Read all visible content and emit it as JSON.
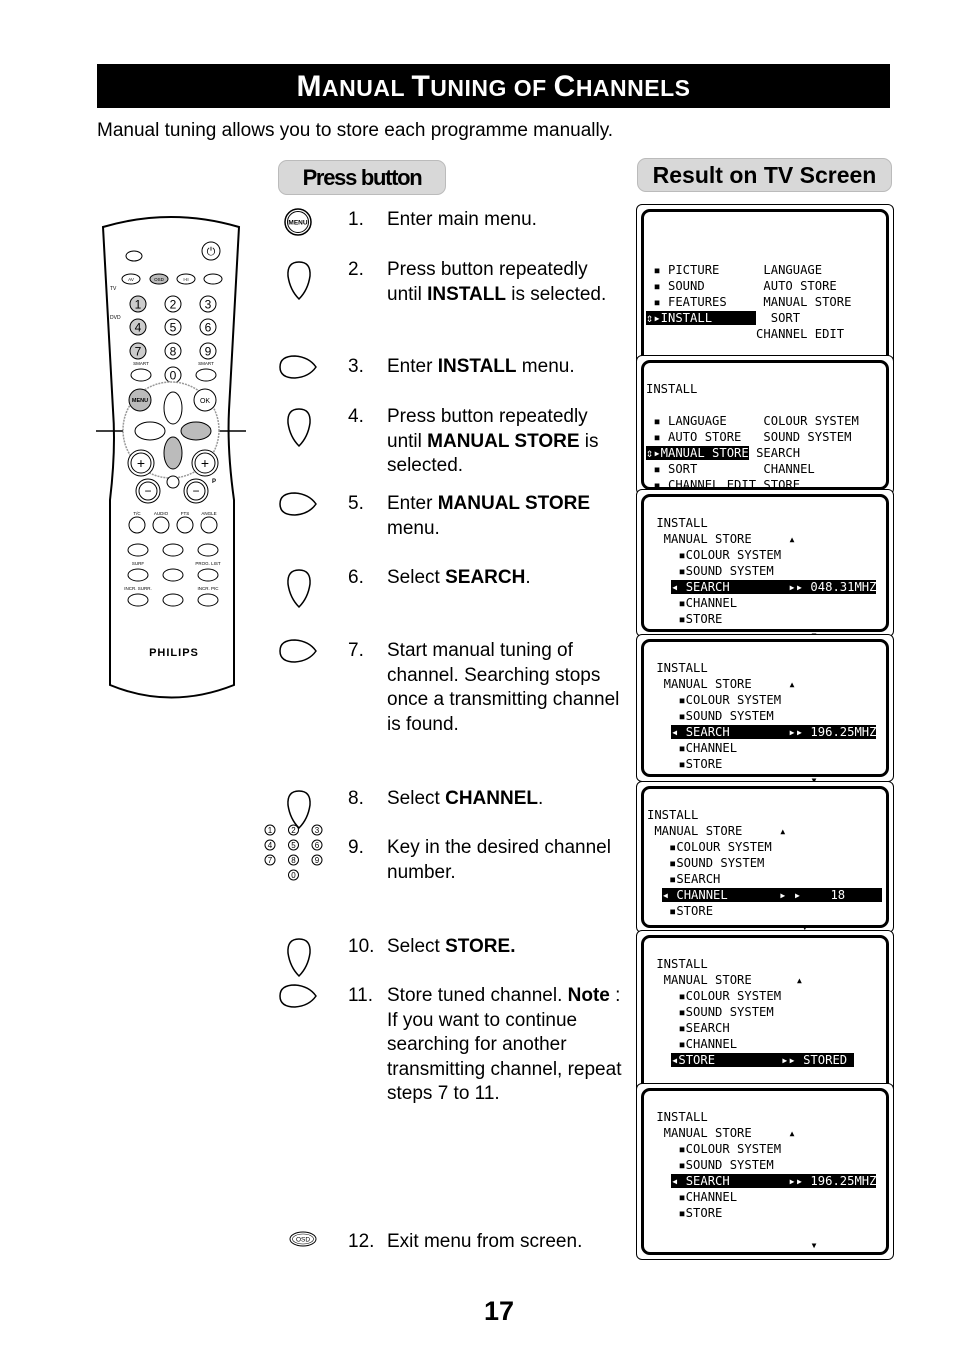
{
  "title": {
    "parts": [
      [
        "M",
        "big"
      ],
      [
        "ANUAL ",
        ""
      ],
      [
        "T",
        "big"
      ],
      [
        "UNING OF ",
        ""
      ],
      [
        "C",
        "big"
      ],
      [
        "HANNELS",
        ""
      ]
    ]
  },
  "intro": "Manual tuning allows you to store each programme manually.",
  "press_button_label": "Press button",
  "result_label": "Result on TV Screen",
  "remote": {
    "brand": "PHILIPS",
    "labels": {
      "tv": "TV",
      "dvd": "DVD",
      "av": "AV",
      "osd": "OSD",
      "dual": "I-II",
      "smart1": "SMART",
      "smart2": "SMART",
      "menu": "MENU",
      "ok": "OK",
      "p": "P",
      "tc": "T/C",
      "audio": "AUDIO",
      "fts": "FTS",
      "angle": "ANGLE",
      "surf": "SURF",
      "prog_list": "PROG. LIST",
      "incr_surr": "INCR. SURR.",
      "incr_pic": "INCR. PIC"
    },
    "digits": [
      "1",
      "2",
      "3",
      "4",
      "5",
      "6",
      "7",
      "8",
      "9",
      "0"
    ]
  },
  "steps": [
    {
      "num": "1.",
      "icon": "menu",
      "segments": [
        [
          "Enter main menu.",
          false
        ]
      ]
    },
    {
      "num": "2.",
      "icon": "down",
      "segments": [
        [
          "Press button repeatedly until ",
          false
        ],
        [
          "INSTALL",
          true
        ],
        [
          " is selected.",
          false
        ]
      ]
    },
    {
      "num": "3.",
      "icon": "right",
      "segments": [
        [
          "Enter ",
          false
        ],
        [
          "INSTALL",
          true
        ],
        [
          " menu.",
          false
        ]
      ]
    },
    {
      "num": "4.",
      "icon": "down",
      "segments": [
        [
          "Press button repeatedly until ",
          false
        ],
        [
          "MANUAL STORE",
          true
        ],
        [
          " is selected.",
          false
        ]
      ]
    },
    {
      "num": "5.",
      "icon": "right",
      "segments": [
        [
          "Enter ",
          false
        ],
        [
          "MANUAL STORE",
          true
        ],
        [
          " menu.",
          false
        ]
      ]
    },
    {
      "num": "6.",
      "icon": "down",
      "segments": [
        [
          "Select ",
          false
        ],
        [
          "SEARCH",
          true
        ],
        [
          ".",
          false
        ]
      ]
    },
    {
      "num": "7.",
      "icon": "right",
      "segments": [
        [
          "Start manual tuning of channel. Searching stops once a transmitting channel is found.",
          false
        ]
      ]
    },
    {
      "num": "8.",
      "icon": "down",
      "segments": [
        [
          "Select ",
          false
        ],
        [
          "CHANNEL",
          true
        ],
        [
          ".",
          false
        ]
      ]
    },
    {
      "num": "9.",
      "icon": "digits",
      "segments": [
        [
          "Key in the desired channel number.",
          false
        ]
      ]
    },
    {
      "num": "10.",
      "icon": "down",
      "segments": [
        [
          "Select ",
          false
        ],
        [
          "STORE.",
          true
        ]
      ]
    },
    {
      "num": "11.",
      "icon": "right",
      "segments": [
        [
          "Store tuned  channel. ",
          false
        ],
        [
          "Note",
          true
        ],
        [
          " : If you want to continue searching for another transmitting channel, repeat steps 7 to 11.",
          false
        ]
      ]
    },
    {
      "num": "12.",
      "icon": "osd",
      "segments": [
        [
          "Exit menu from screen.",
          false
        ]
      ]
    }
  ],
  "osd_label": "OSD",
  "screens": [
    {
      "lines": [
        [
          "",
          "",
          ""
        ],
        [
          "",
          "",
          ""
        ],
        [
          "",
          "",
          ""
        ],
        [
          " ▪ PICTURE      LANGUAGE",
          "",
          ""
        ],
        [
          " ▪ SOUND        AUTO STORE",
          "",
          ""
        ],
        [
          " ▪ FEATURES     MANUAL STORE",
          "",
          ""
        ],
        [
          "",
          "⇕▸INSTALL      ",
          "  SORT"
        ],
        [
          "               CHANNEL EDIT",
          "",
          ""
        ]
      ]
    },
    {
      "lines": [
        [
          "",
          "",
          ""
        ],
        [
          "INSTALL",
          "",
          ""
        ],
        [
          "",
          "",
          ""
        ],
        [
          " ▪ LANGUAGE     COLOUR SYSTEM",
          "",
          ""
        ],
        [
          " ▪ AUTO STORE   SOUND SYSTEM",
          "",
          ""
        ],
        [
          "",
          "⇕▸MANUAL STORE",
          " SEARCH"
        ],
        [
          " ▪ SORT         CHANNEL",
          "",
          ""
        ],
        [
          " ▪ CHANNEL EDIT STORE",
          "",
          ""
        ],
        [
          " ▪",
          "",
          ""
        ]
      ]
    },
    {
      "lines": [
        [
          "",
          "",
          ""
        ],
        [
          " INSTALL",
          "",
          ""
        ],
        [
          "  MANUAL STORE     ▴",
          "",
          ""
        ],
        [
          "    ▪COLOUR SYSTEM",
          "",
          ""
        ],
        [
          "    ▪SOUND SYSTEM",
          "",
          ""
        ],
        [
          "   ",
          "◂ SEARCH        ▸▸ 048.31MHZ",
          ""
        ],
        [
          "    ▪CHANNEL",
          "",
          ""
        ],
        [
          "    ▪STORE",
          "",
          ""
        ],
        [
          "                      ▾",
          "",
          ""
        ]
      ]
    },
    {
      "lines": [
        [
          "",
          "",
          ""
        ],
        [
          " INSTALL",
          "",
          ""
        ],
        [
          "  MANUAL STORE     ▴",
          "",
          ""
        ],
        [
          "    ▪COLOUR SYSTEM",
          "",
          ""
        ],
        [
          "    ▪SOUND SYSTEM",
          "",
          ""
        ],
        [
          "   ",
          "◂ SEARCH        ▸▸ 196.25MHZ",
          ""
        ],
        [
          "    ▪CHANNEL",
          "",
          ""
        ],
        [
          "    ▪STORE",
          "",
          ""
        ],
        [
          "                      ▾",
          "",
          ""
        ]
      ]
    },
    {
      "lines": [
        [
          "",
          "",
          ""
        ],
        [
          "INSTALL",
          "",
          ""
        ],
        [
          " MANUAL STORE     ▴",
          "",
          ""
        ],
        [
          "   ▪COLOUR SYSTEM",
          "",
          ""
        ],
        [
          "   ▪SOUND SYSTEM",
          "",
          ""
        ],
        [
          "   ▪SEARCH",
          "",
          ""
        ],
        [
          "  ",
          "◂ CHANNEL       ▸ ▸    18     ",
          ""
        ],
        [
          "   ▪STORE",
          "",
          ""
        ],
        [
          "                     ▾",
          "",
          ""
        ]
      ]
    },
    {
      "lines": [
        [
          "",
          "",
          ""
        ],
        [
          " INSTALL",
          "",
          ""
        ],
        [
          "  MANUAL STORE      ▴",
          "",
          ""
        ],
        [
          "    ▪COLOUR SYSTEM",
          "",
          ""
        ],
        [
          "    ▪SOUND SYSTEM",
          "",
          ""
        ],
        [
          "    ▪SEARCH",
          "",
          ""
        ],
        [
          "    ▪CHANNEL",
          "",
          ""
        ],
        [
          "   ",
          "◂STORE         ▸▸ STORED ",
          ""
        ]
      ]
    },
    {
      "lines": [
        [
          "",
          "",
          ""
        ],
        [
          " INSTALL",
          "",
          ""
        ],
        [
          "  MANUAL STORE     ▴",
          "",
          ""
        ],
        [
          "    ▪COLOUR SYSTEM",
          "",
          ""
        ],
        [
          "    ▪SOUND SYSTEM",
          "",
          ""
        ],
        [
          "   ",
          "◂ SEARCH        ▸▸ 196.25MHZ",
          ""
        ],
        [
          "    ▪CHANNEL",
          "",
          ""
        ],
        [
          "    ▪STORE",
          "",
          ""
        ],
        [
          "",
          "",
          ""
        ],
        [
          "                      ▾",
          "",
          ""
        ]
      ]
    }
  ],
  "page_number": "17"
}
